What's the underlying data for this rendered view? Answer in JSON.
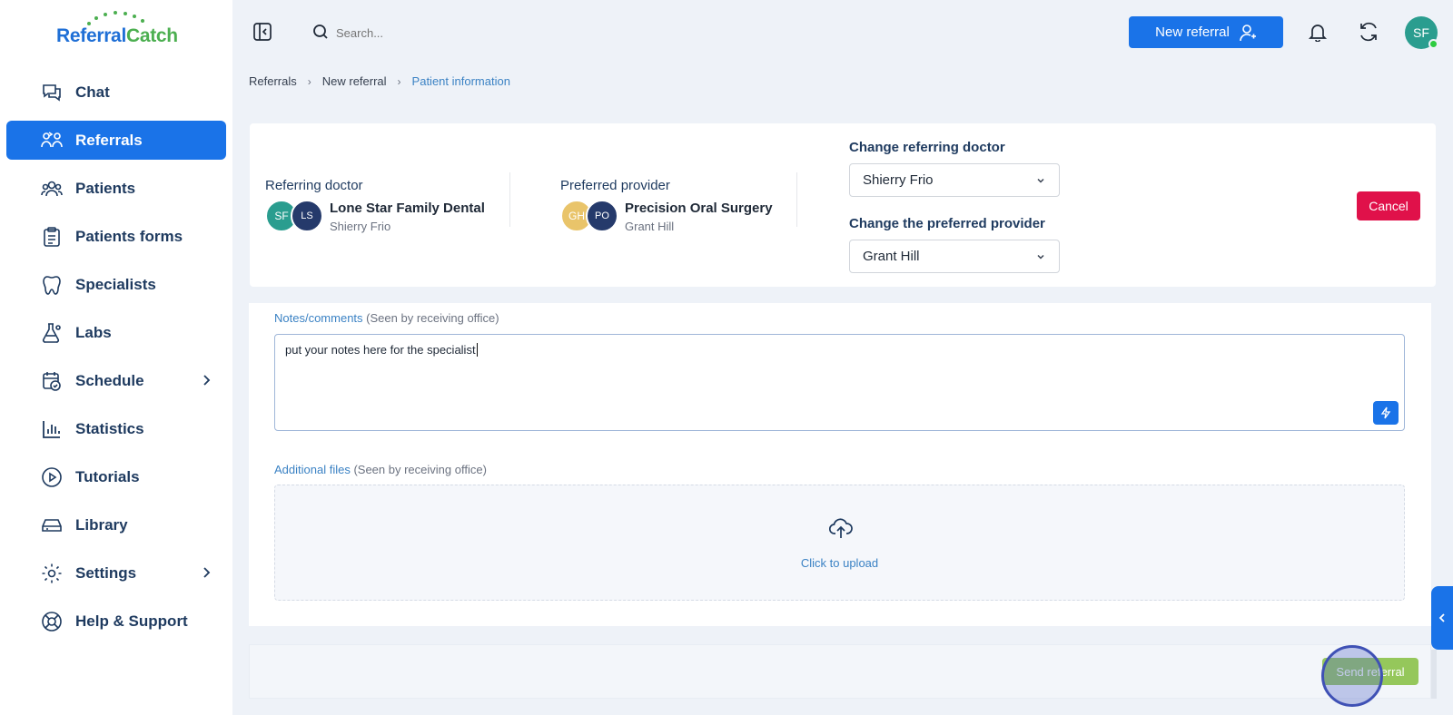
{
  "app": {
    "logo_text_a": "Referral",
    "logo_text_b": "Catch"
  },
  "sidebar": {
    "items": [
      {
        "label": "Chat",
        "icon": "chat-icon"
      },
      {
        "label": "Referrals",
        "icon": "referrals-icon",
        "active": true
      },
      {
        "label": "Patients",
        "icon": "patients-icon"
      },
      {
        "label": "Patients forms",
        "icon": "clipboard-icon"
      },
      {
        "label": "Specialists",
        "icon": "tooth-icon"
      },
      {
        "label": "Labs",
        "icon": "flask-icon"
      },
      {
        "label": "Schedule",
        "icon": "calendar-check-icon",
        "expandable": true
      },
      {
        "label": "Statistics",
        "icon": "bar-chart-icon"
      },
      {
        "label": "Tutorials",
        "icon": "play-circle-icon"
      },
      {
        "label": "Library",
        "icon": "drive-icon"
      },
      {
        "label": "Settings",
        "icon": "gear-icon",
        "expandable": true
      },
      {
        "label": "Help & Support",
        "icon": "lifebuoy-icon"
      }
    ]
  },
  "header": {
    "search_placeholder": "Search...",
    "new_referral_label": "New referral",
    "user_initials": "SF"
  },
  "breadcrumb": {
    "items": [
      "Referrals",
      "New referral",
      "Patient information"
    ]
  },
  "referral": {
    "referring_doctor_title": "Referring doctor",
    "referring_avatars": [
      "SF",
      "LS"
    ],
    "referring_name": "Lone Star Family Dental",
    "referring_sub": "Shierry Frio",
    "preferred_provider_title": "Preferred provider",
    "provider_avatars": [
      "GH",
      "PO"
    ],
    "provider_name": "Precision Oral Surgery",
    "provider_sub": "Grant Hill",
    "change_doctor_label": "Change referring doctor",
    "change_doctor_value": "Shierry Frio",
    "change_provider_label": "Change the preferred provider",
    "change_provider_value": "Grant Hill",
    "cancel_label": "Cancel"
  },
  "notes": {
    "label": "Notes/comments",
    "hint": "(Seen by receiving office)",
    "value": "put your notes here for the specialist"
  },
  "files": {
    "label": "Additional files",
    "hint": "(Seen by receiving office)",
    "upload_text": "Click to upload"
  },
  "footer": {
    "send_label": "Send referral"
  },
  "colors": {
    "primary": "#1a73e8",
    "danger": "#e0114a",
    "success": "#8bc34a",
    "teal": "#2a9d8f",
    "navy": "#253a6b",
    "gold": "#e9c46a"
  }
}
